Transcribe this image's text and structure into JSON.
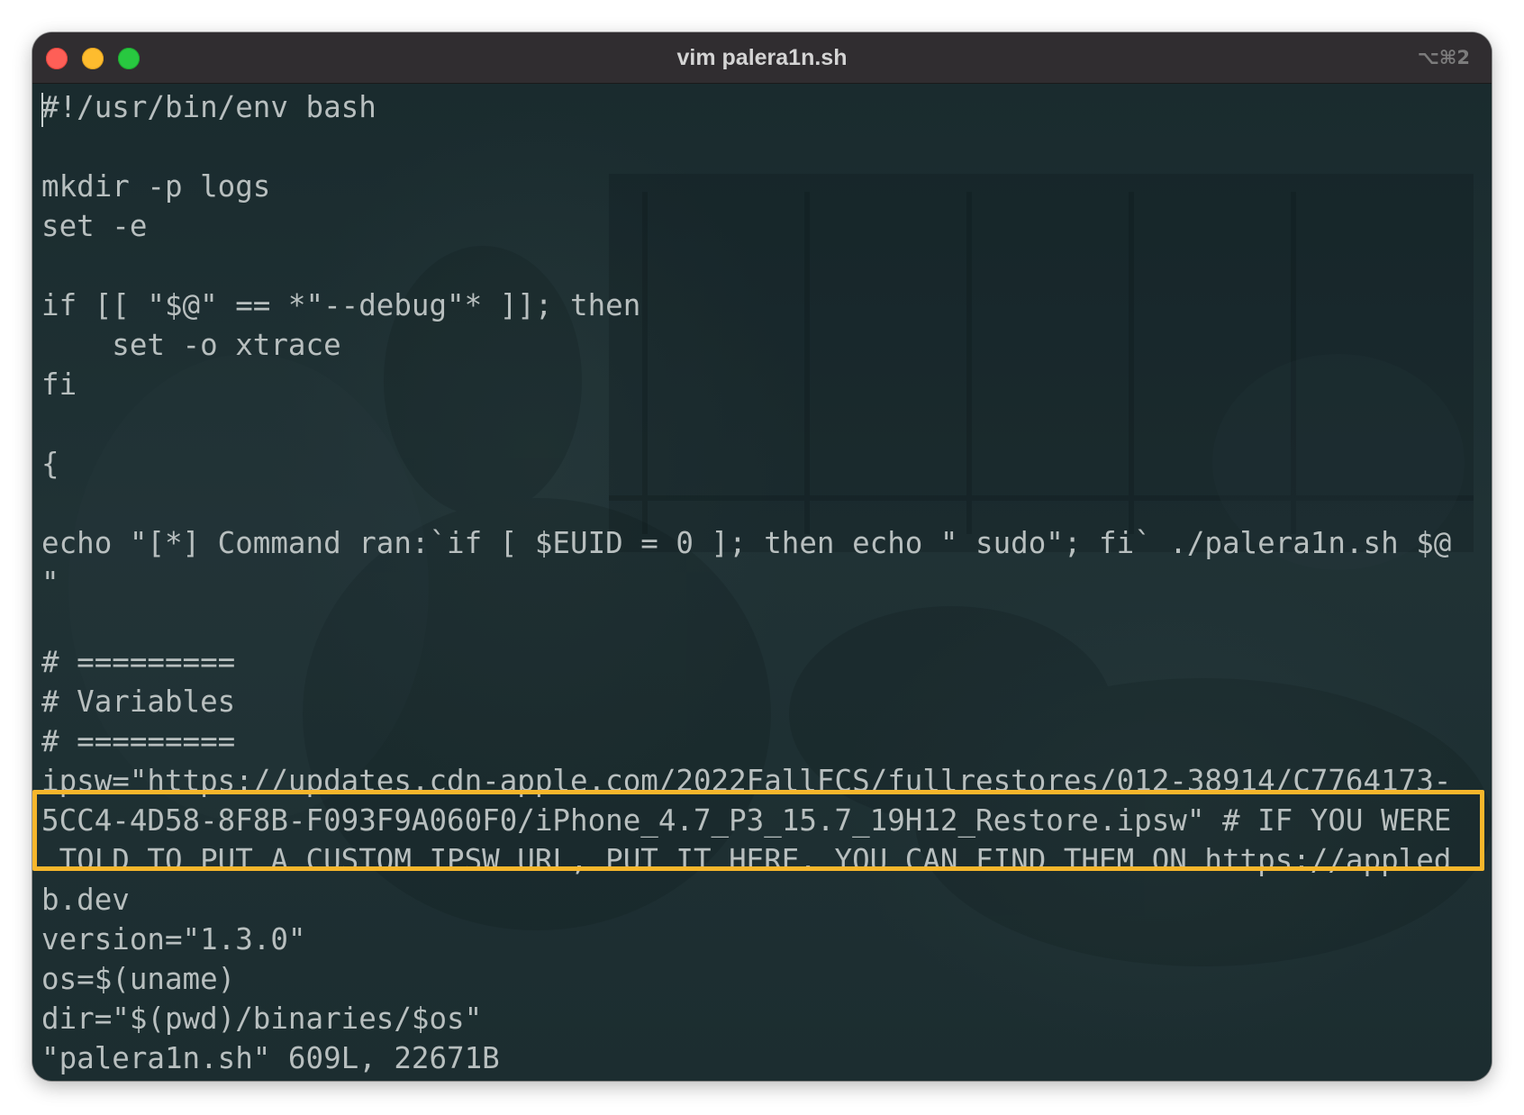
{
  "window": {
    "title": "vim palera1n.sh",
    "shortcut": "⌥⌘2"
  },
  "editor": {
    "lines": [
      "#!/usr/bin/env bash",
      "",
      "mkdir -p logs",
      "set -e",
      "",
      "if [[ \"$@\" == *\"--debug\"* ]]; then",
      "    set -o xtrace",
      "fi",
      "",
      "{",
      "",
      "echo \"[*] Command ran:`if [ $EUID = 0 ]; then echo \" sudo\"; fi` ./palera1n.sh $@",
      "\"",
      "",
      "# =========",
      "# Variables",
      "# =========",
      "ipsw=\"https://updates.cdn-apple.com/2022FallFCS/fullrestores/012-38914/C7764173-",
      "5CC4-4D58-8F8B-F093F9A060F0/iPhone_4.7_P3_15.7_19H12_Restore.ipsw\" # IF YOU WERE",
      " TOLD TO PUT A CUSTOM IPSW URL, PUT IT HERE. YOU CAN FIND THEM ON https://appled",
      "b.dev",
      "version=\"1.3.0\"",
      "os=$(uname)",
      "dir=\"$(pwd)/binaries/$os\"",
      "\"palera1n.sh\" 609L, 22671B"
    ]
  },
  "colors": {
    "highlight_border": "#f6b62b",
    "terminal_text": "#b8bfbf",
    "titlebar": "#302d30"
  }
}
